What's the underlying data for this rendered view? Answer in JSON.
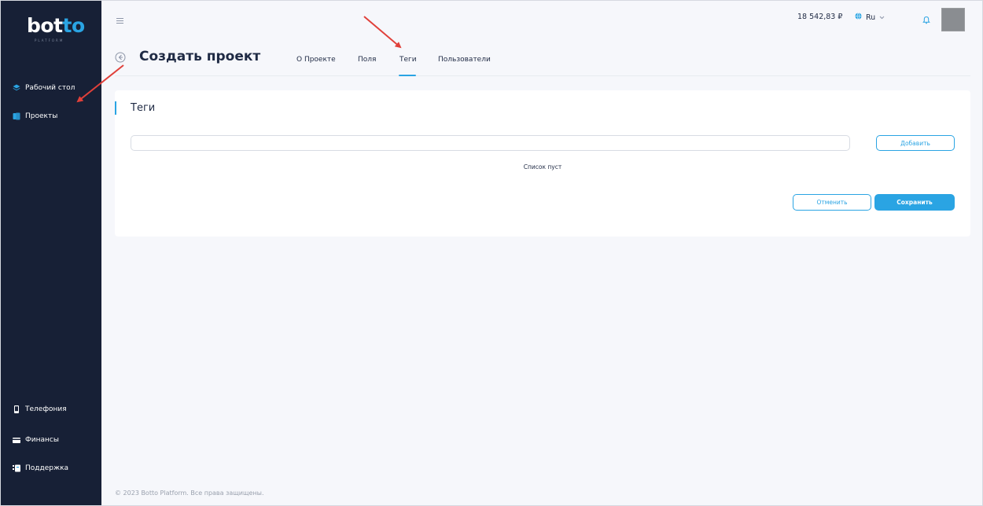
{
  "brand": {
    "logo_main": "bot",
    "logo_accent": "to",
    "logo_sub": "PLATFORM"
  },
  "sidebar": {
    "items": [
      {
        "label": "Рабочий стол",
        "icon": "layers-icon"
      },
      {
        "label": "Проекты",
        "icon": "folder-icon"
      },
      {
        "label": "Телефония",
        "icon": "phone-icon"
      },
      {
        "label": "Финансы",
        "icon": "wallet-icon"
      },
      {
        "label": "Поддержка",
        "icon": "support-icon"
      }
    ]
  },
  "topbar": {
    "balance": "18 542,83 ₽",
    "language": "Ru"
  },
  "page": {
    "title": "Создать проект",
    "tabs": [
      {
        "label": "О Проекте"
      },
      {
        "label": "Поля"
      },
      {
        "label": "Теги",
        "active": true
      },
      {
        "label": "Пользователи"
      }
    ]
  },
  "card": {
    "title": "Теги",
    "input_value": "",
    "add_label": "Добавить",
    "empty_text": "Список пуст",
    "cancel_label": "Отменить",
    "save_label": "Сохранить"
  },
  "footer": {
    "text": "© 2023 Botto Platform. Все права защищены."
  },
  "colors": {
    "accent": "#2aa4e3",
    "sidebar_bg": "#172036",
    "annotation_arrow": "#e0403a"
  }
}
